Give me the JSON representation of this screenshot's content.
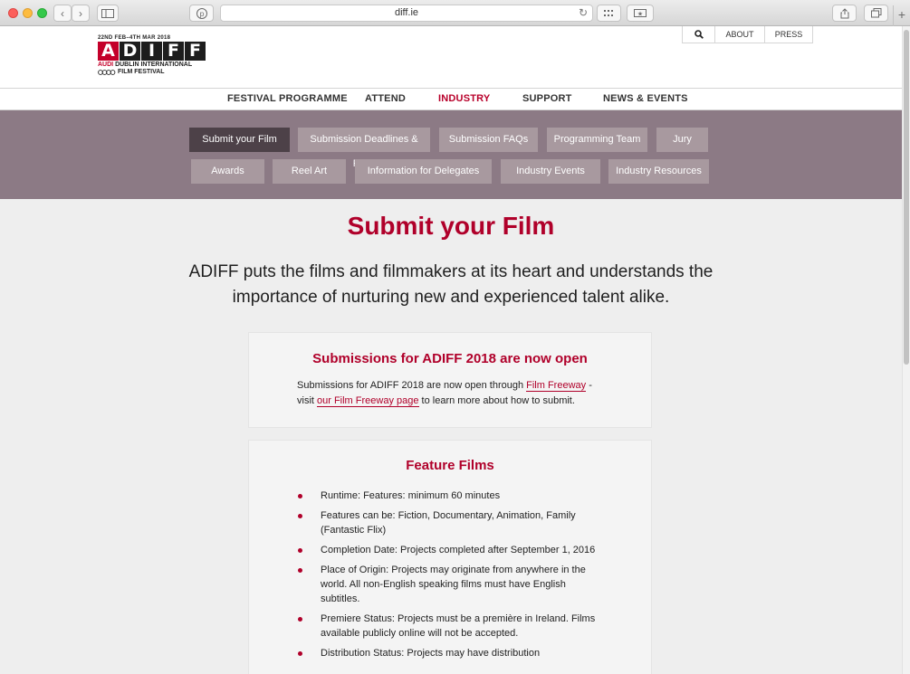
{
  "browser": {
    "url": "diff.ie"
  },
  "header": {
    "logo": {
      "dates": "22ND FEB–4TH MAR 2018",
      "letters": [
        "A",
        "D",
        "I",
        "F",
        "F"
      ],
      "line1_brand": "AUDI",
      "line1_rest": " DUBLIN INTERNATIONAL",
      "line2": "FILM FESTIVAL"
    },
    "util": {
      "search_icon": "search-icon",
      "about": "ABOUT",
      "press": "PRESS"
    },
    "nav": [
      {
        "label": "FESTIVAL PROGRAMME"
      },
      {
        "label": "ATTEND"
      },
      {
        "label": "INDUSTRY"
      },
      {
        "label": "SUPPORT"
      },
      {
        "label": "NEWS & EVENTS"
      }
    ],
    "subnav": [
      {
        "label": "Submit your Film"
      },
      {
        "label": "Submission Deadlines & Fees"
      },
      {
        "label": "Submission FAQs"
      },
      {
        "label": "Programming Team"
      },
      {
        "label": "Jury"
      },
      {
        "label": "Awards"
      },
      {
        "label": "Reel Art"
      },
      {
        "label": "Information for Delegates"
      },
      {
        "label": "Industry Events"
      },
      {
        "label": "Industry Resources"
      }
    ]
  },
  "main": {
    "title": "Submit your Film",
    "intro": "ADIFF puts the films and filmmakers at its heart and understands the importance of nurturing new and experienced talent alike.",
    "submissions_card": {
      "title": "Submissions for ADIFF 2018 are now open",
      "text_before": "Submissions for ADIFF 2018 are now open through ",
      "link1": "Film Freeway",
      "text_middle": " - visit ",
      "link2": "our Film Freeway page",
      "text_after": " to learn more about how to submit."
    },
    "features_card": {
      "title": "Feature Films",
      "items": [
        "Runtime: Features: minimum 60 minutes",
        "Features can be: Fiction, Documentary, Animation, Family (Fantastic Flix)",
        "Completion Date: Projects completed after September 1, 2016",
        "Place of Origin: Projects may originate from anywhere in the world. All non-English speaking films must have English subtitles.",
        "Premiere Status: Projects must be a première in Ireland. Films available publicly online will not be accepted.",
        "Distribution Status: Projects may have distribution"
      ]
    }
  },
  "colors": {
    "brand_red": "#b0002a",
    "subnav_bg": "#8c7a85",
    "subnav_active": "#4d4148"
  }
}
